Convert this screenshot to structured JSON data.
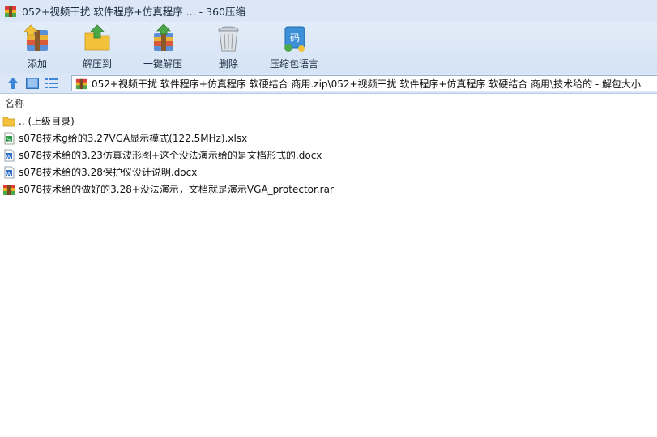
{
  "window": {
    "title": "052+视频干扰   软件程序+仿真程序 ... - 360压缩"
  },
  "toolbar": {
    "buttons": [
      {
        "label": "添加",
        "icon": "add-archive-icon"
      },
      {
        "label": "解压到",
        "icon": "extract-to-icon"
      },
      {
        "label": "一键解压",
        "icon": "one-click-extract-icon"
      },
      {
        "label": "删除",
        "icon": "trash-icon"
      },
      {
        "label": "压缩包语言",
        "icon": "archive-language-icon"
      }
    ]
  },
  "navigation": {
    "icons": [
      "up-arrow-icon",
      "thumbnail-view-icon",
      "list-view-icon"
    ]
  },
  "address": {
    "path": "052+视频干扰   软件程序+仿真程序   软硬结合  商用.zip\\052+视频干扰   软件程序+仿真程序   软硬结合  商用\\技术给的 - 解包大小"
  },
  "filelist": {
    "column_header": "名称",
    "rows": [
      {
        "name": ".. (上级目录)",
        "icon": "folder-icon"
      },
      {
        "name": "s078技术g给的3.27VGA显示模式(122.5MHz).xlsx",
        "icon": "excel-file-icon"
      },
      {
        "name": "s078技术给的3.23仿真波形图+这个没法演示给的是文档形式的.docx",
        "icon": "word-file-icon"
      },
      {
        "name": "s078技术给的3.28保护仪设计说明.docx",
        "icon": "word-file-icon"
      },
      {
        "name": "s078技术给的做好的3.28+没法演示，文档就是演示VGA_protector.rar",
        "icon": "rar-file-icon"
      }
    ]
  }
}
